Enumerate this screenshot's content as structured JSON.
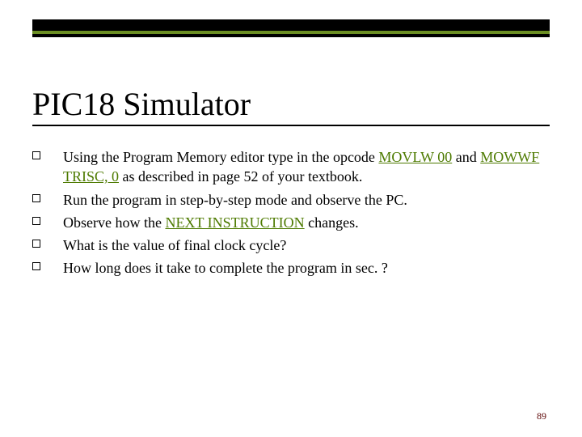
{
  "title": "PIC18 Simulator",
  "bullets": [
    {
      "pre": "Using the Program Memory editor type in the opcode ",
      "code1": "MOVLW 00",
      "mid": " and ",
      "code2": "MOWWF TRISC, 0",
      "post": " as described in page 52 of your textbook."
    },
    {
      "text": "Run the program in step-by-step mode and observe the PC."
    },
    {
      "pre": "Observe how the ",
      "code1": "NEXT INSTRUCTION",
      "post": " changes."
    },
    {
      "text": "What is the value of final clock cycle?"
    },
    {
      "text": "How long does it take to complete the program in sec. ?"
    }
  ],
  "page_number": "89"
}
